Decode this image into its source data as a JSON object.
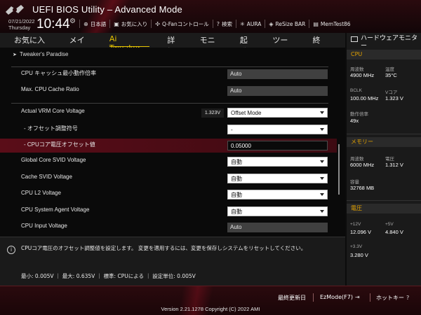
{
  "header": {
    "title": "UEFI BIOS Utility – Advanced Mode",
    "date": "07/21/2022",
    "weekday": "Thursday",
    "time": "10:44",
    "toolbar": [
      {
        "icon": "globe-icon",
        "label": "日本語"
      },
      {
        "icon": "favorite-icon",
        "label": "お気に入り"
      },
      {
        "icon": "fan-icon",
        "label": "Q-Fanコントロール"
      },
      {
        "icon": "search-icon",
        "label": "検索"
      },
      {
        "icon": "aura-icon",
        "label": "AURA"
      },
      {
        "icon": "resize-bar-icon",
        "label": "ReSize BAR"
      },
      {
        "icon": "memtest-icon",
        "label": "MemTest86"
      }
    ]
  },
  "nav": {
    "tabs": [
      "お気に入り",
      "メイン",
      "Ai Tweaker",
      "詳細",
      "モニタ",
      "起動",
      "ツール",
      "終了"
    ],
    "active": "Ai Tweaker"
  },
  "main": {
    "breadcrumb": "Tweaker's Paradise",
    "rows": [
      {
        "label": "CPU キャッシュ最小動作倍率",
        "value": "Auto",
        "control": "readonly"
      },
      {
        "label": "Max. CPU Cache Ratio",
        "value": "Auto",
        "control": "readonly"
      },
      {
        "label": "Actual VRM Core Voltage",
        "value": "Offset Mode",
        "control": "dropdown",
        "badge": "1.323V"
      },
      {
        "label": "- オフセット調整符号",
        "value": "-",
        "control": "dropdown"
      },
      {
        "label": "- CPUコア電圧オフセット値",
        "value": "0.05000",
        "control": "input",
        "selected": true
      },
      {
        "label": "Global Core SVID Voltage",
        "value": "自動",
        "control": "dropdown"
      },
      {
        "label": "Cache SVID Voltage",
        "value": "自動",
        "control": "dropdown"
      },
      {
        "label": "CPU L2 Voltage",
        "value": "自動",
        "control": "dropdown"
      },
      {
        "label": "CPU System Agent Voltage",
        "value": "自動",
        "control": "dropdown"
      },
      {
        "label": "CPU Input Voltage",
        "value": "Auto",
        "control": "readonly"
      }
    ]
  },
  "help": {
    "text": "CPUコア電圧のオフセット調整値を設定します。 変更を適用するには、変更を保存しシステムをリセットしてください。",
    "range": "最小: 0.005V ｜ 最大: 0.635V ｜ 標準: CPUによる ｜ 設定単位: 0.005V"
  },
  "hw": {
    "title": "ハードウェアモニター",
    "cpu": {
      "section": "CPU",
      "freq_label": "周波数",
      "freq": "4900 MHz",
      "temp_label": "温度",
      "temp": "35°C",
      "bclk_label": "BCLK",
      "bclk": "100.00 MHz",
      "vcore_label": "Vコア",
      "vcore": "1.323 V",
      "ratio_label": "動作倍率",
      "ratio": "49x"
    },
    "memory": {
      "section": "メモリー",
      "freq_label": "周波数",
      "freq": "6000 MHz",
      "volt_label": "電圧",
      "volt": "1.312 V",
      "cap_label": "容量",
      "cap": "32768 MB"
    },
    "voltage": {
      "section": "電圧",
      "v12_label": "+12V",
      "v12": "12.096 V",
      "v5_label": "+5V",
      "v5": "4.840 V",
      "v33_label": "+3.3V",
      "v33": "3.280 V"
    }
  },
  "footer": {
    "last_modified": "最終更新日",
    "ezmode": "EzMode(F7)",
    "hotkeys": "ホットキー",
    "hotkeys_key": "?",
    "version": "Version 2.21.1278 Copyright (C) 2022 AMI"
  },
  "colors": {
    "accent": "#e4c200",
    "selected_row": "#5a0d18",
    "hw_section_text": "#e0a000"
  }
}
